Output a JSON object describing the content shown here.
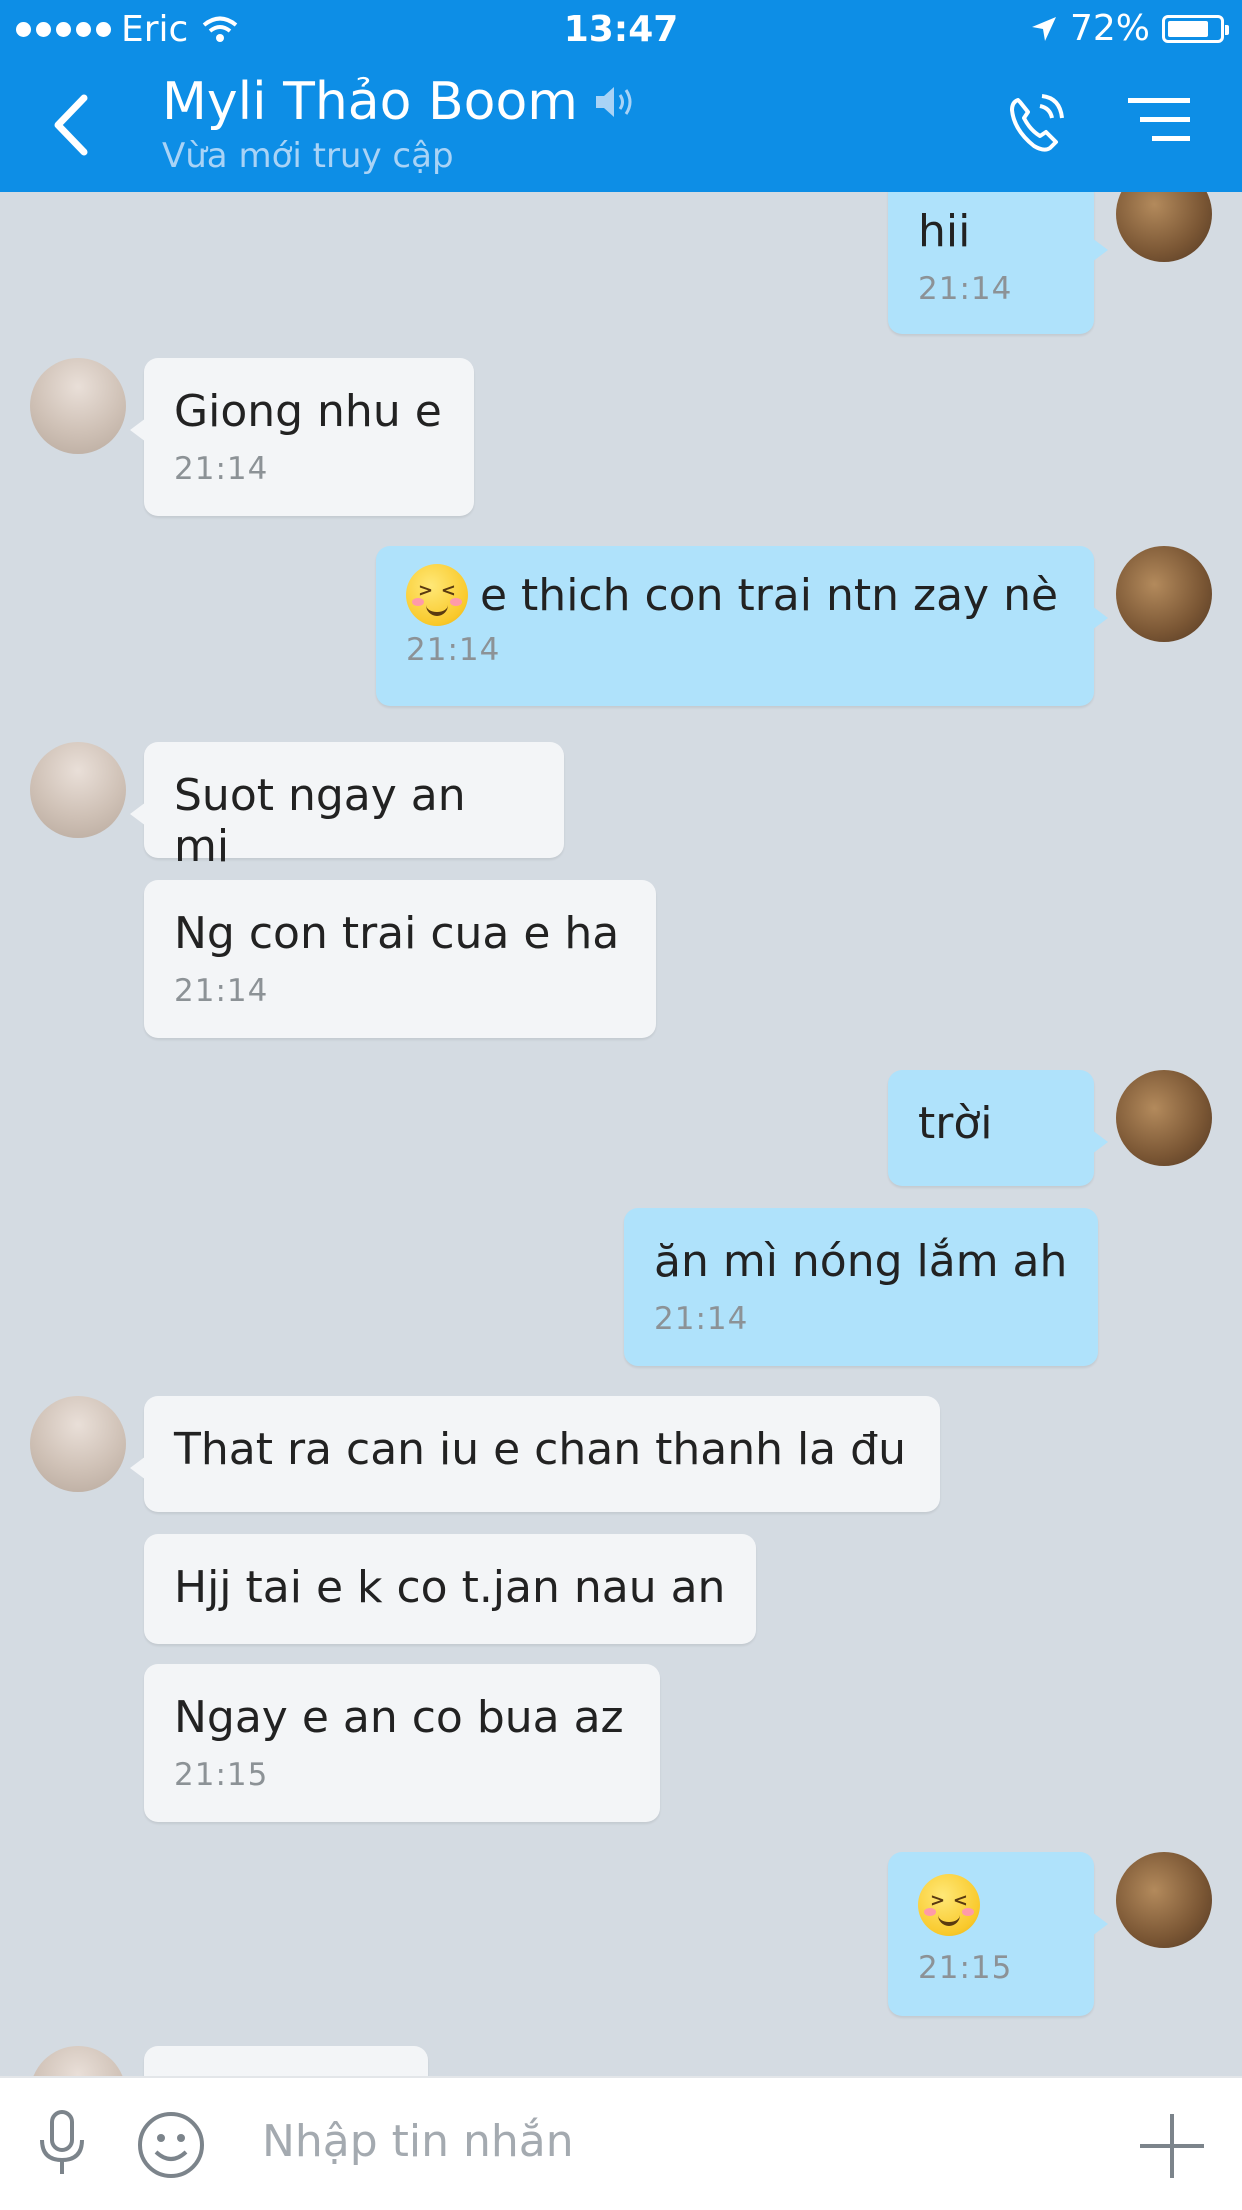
{
  "status_bar": {
    "carrier": "Eric",
    "time": "13:47",
    "battery": "72%",
    "battery_level": 0.72
  },
  "header": {
    "title": "Myli Thảo Boom",
    "subtitle": "Vừa mới truy cập"
  },
  "messages": [
    {
      "side": "out",
      "text": "hii",
      "time": "21:14"
    },
    {
      "side": "in",
      "text": "Giong nhu e",
      "time": "21:14"
    },
    {
      "side": "out",
      "text": "e thich con trai ntn zay nè",
      "time": "21:14",
      "emoji": "laughing-face-emoji"
    },
    {
      "side": "in",
      "text": "Suot ngay an mi",
      "time": ""
    },
    {
      "side": "in",
      "text": "Ng con trai cua e ha",
      "time": "21:14"
    },
    {
      "side": "out",
      "text": "trời",
      "time": ""
    },
    {
      "side": "out",
      "text": "ăn mì nóng lắm ah",
      "time": "21:14"
    },
    {
      "side": "in",
      "text": "That ra can iu e chan thanh la đu",
      "time": ""
    },
    {
      "side": "in",
      "text": "Hjj tai e k co t.jan nau an",
      "time": ""
    },
    {
      "side": "in",
      "text": "Ngay e an co bua az",
      "time": "21:15"
    },
    {
      "side": "out",
      "text": "",
      "time": "21:15",
      "emoji": "laughing-face-emoji"
    }
  ],
  "input": {
    "placeholder": "Nhập tin nhắn"
  },
  "colors": {
    "header": "#0d8ee6",
    "chat_background": "#d4dbe2",
    "outgoing_bubble": "#afe2fb",
    "incoming_bubble": "#f3f5f7"
  }
}
